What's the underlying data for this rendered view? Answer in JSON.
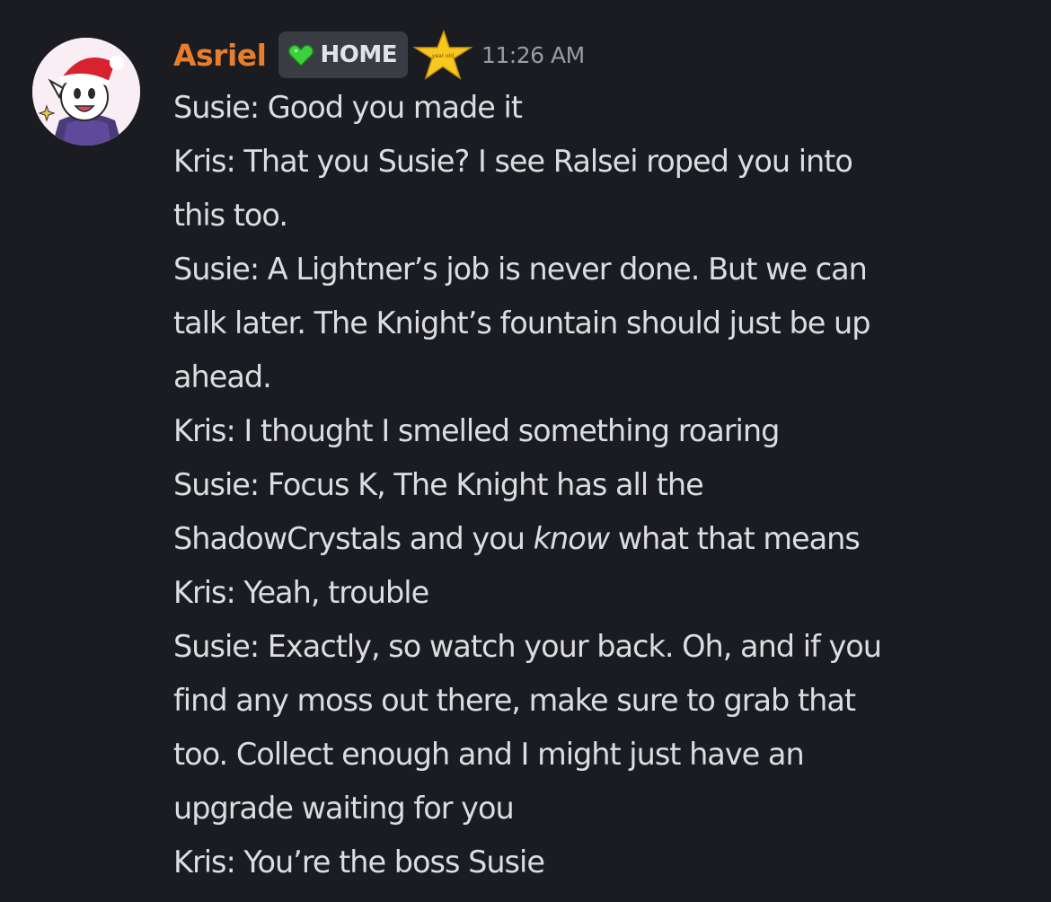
{
  "message": {
    "author": "Asriel",
    "tag": {
      "label": "HOME",
      "icon": "green-heart-icon",
      "color": "#3ecf3e"
    },
    "badge_icon": "gold-star-badge-icon",
    "badge_text": "year old",
    "timestamp": "11:26 AM",
    "username_color": "#e67e2e",
    "lines": [
      "Susie: Good you made it",
      "Kris: That you Susie? I see Ralsei roped you into",
      "this too.",
      "Susie: A Lightner’s job is never done. But we can",
      "talk later. The Knight’s fountain should just be up",
      "ahead.",
      "Kris: I thought I smelled something roaring",
      "Susie: Focus K, The Knight has all the",
      {
        "before": "ShadowCrystals and you ",
        "italic": "know",
        "after": " what that means"
      },
      "Kris: Yeah, trouble",
      "Susie: Exactly, so watch your back. Oh, and if you",
      "find any moss out there, make sure to grab that",
      "too. Collect enough and I might just have an",
      "upgrade waiting for you",
      "Kris: You’re the boss Susie"
    ]
  }
}
